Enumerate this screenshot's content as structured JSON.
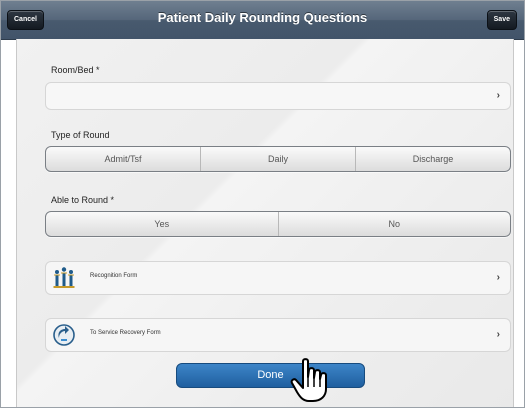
{
  "header": {
    "title": "Patient Daily Rounding Questions",
    "cancel_label": "Cancel",
    "save_label": "Save"
  },
  "room_bed": {
    "label": "Room/Bed *",
    "value": "",
    "chevron": "›"
  },
  "type_of_round": {
    "label": "Type of Round",
    "options": [
      "Admit/Tsf",
      "Daily",
      "Discharge"
    ]
  },
  "able_to_round": {
    "label": "Able to Round *",
    "options": [
      "Yes",
      "No"
    ]
  },
  "forms": [
    {
      "label": "Recognition Form",
      "icon": "recognition-people-icon"
    },
    {
      "label": "To Service Recovery Form",
      "icon": "service-recovery-icon"
    }
  ],
  "done_label": "Done",
  "colors": {
    "titlebar": "#485a6e",
    "done_button": "#2b6fb1",
    "panel_bg": "#eeeeee"
  }
}
